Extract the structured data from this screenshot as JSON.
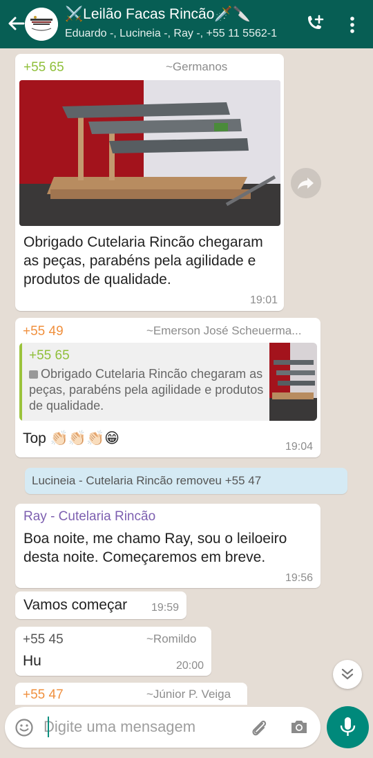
{
  "header": {
    "title": "⚔️Leilão Facas Rincão🗡️🔪",
    "subtitle": "Eduardo -, Lucineia -, Ray -, +55 11 5562-1",
    "avatar_icon": "group-knife-logo",
    "back_icon": "arrow-left-icon",
    "call_icon": "add-call-icon",
    "menu_icon": "more-vertical-icon"
  },
  "messages": [
    {
      "sender": "+55 65",
      "sender_color": "#8fbf3a",
      "name": "~Germanos",
      "text": "Obrigado Cutelaria Rincão chegaram as peças, parabéns pela agilidade e produtos de qualidade.",
      "time": "19:01",
      "has_image": true
    },
    {
      "sender": "+55 49",
      "sender_color": "#f0903e",
      "name": "~Emerson José Scheuerma...",
      "quote_sender": "+55 65",
      "quote_text": "Obrigado Cutelaria Rincão chegaram as peças, parabéns pela agilidade e produtos de qualidade.",
      "text": "Top 👏🏻👏🏻👏🏻😁",
      "time": "19:04"
    },
    {
      "system": "Lucineia - Cutelaria Rincão removeu +55 47"
    },
    {
      "sender": "Ray - Cutelaria Rincão",
      "sender_color": "#7d5fb0",
      "text": "Boa noite, me chamo Ray, sou o leiloeiro desta noite. Começaremos em breve.",
      "time": "19:56"
    },
    {
      "text": "Vamos começar",
      "time": "19:59"
    },
    {
      "sender": "+55 45",
      "sender_color": "#555555",
      "name": "~Romildo",
      "text": "Hu",
      "time": "20:00"
    },
    {
      "sender": "+55 47",
      "sender_color": "#f0903e",
      "name": "~Júnior P. Veiga"
    }
  ],
  "input": {
    "placeholder": "Digite uma mensagem",
    "emoji_icon": "smile-icon",
    "attach_icon": "paperclip-icon",
    "camera_icon": "camera-icon",
    "mic_icon": "mic-icon"
  },
  "colors": {
    "header_bg": "#075e54",
    "chat_bg": "#e5ddd5",
    "accent": "#00897b",
    "system_bg": "#d5eaf4"
  }
}
